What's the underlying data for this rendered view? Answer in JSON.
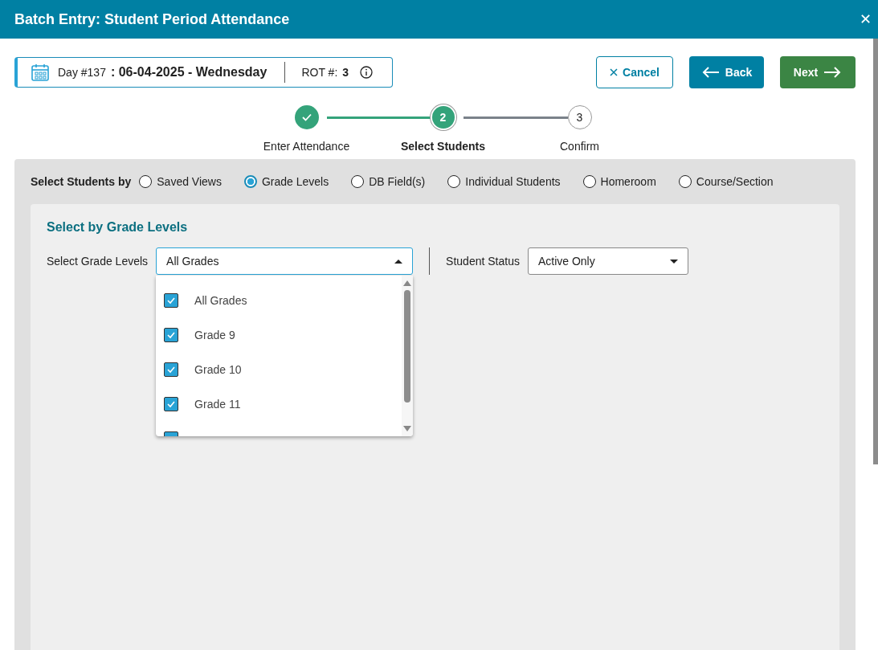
{
  "window": {
    "title": "Batch Entry: Student Period Attendance",
    "close": "✕"
  },
  "day_banner": {
    "day_label": "Day #137",
    "date": ": 06-04-2025 - Wednesday",
    "rot_label": "ROT #:",
    "rot_value": "3"
  },
  "buttons": [
    {
      "kind": "cancel",
      "label": "Cancel"
    },
    {
      "kind": "back",
      "label": "Back"
    },
    {
      "kind": "next",
      "label": "Next"
    }
  ],
  "steps": [
    {
      "label": "Enter Attendance",
      "completed": true,
      "selected": false
    },
    {
      "number": "2",
      "label": "Select Students",
      "completed": false,
      "selected": true
    },
    {
      "number": "3",
      "label": "Confirm",
      "completed": false,
      "selected": false
    }
  ],
  "select_by": {
    "label": "Select Students by",
    "options": [
      {
        "label": "Saved Views",
        "selected": false
      },
      {
        "label": "Grade Levels",
        "selected": true
      },
      {
        "label": "DB Field(s)",
        "selected": false
      },
      {
        "label": "Individual Students",
        "selected": false
      },
      {
        "label": "Homeroom",
        "selected": false
      },
      {
        "label": "Course/Section",
        "selected": false
      }
    ]
  },
  "section": {
    "title": "Select by Grade Levels",
    "grade_label": "Select Grade Levels",
    "grade_value": "All Grades",
    "expanded": true,
    "status_label": "Student Status",
    "status_value": "Active Only"
  },
  "grade_options": [
    {
      "label": "All Grades",
      "checked": true
    },
    {
      "label": "Grade 9",
      "checked": true
    },
    {
      "label": "Grade 10",
      "checked": true
    },
    {
      "label": "Grade 11",
      "checked": true
    },
    {
      "checked": true
    }
  ]
}
